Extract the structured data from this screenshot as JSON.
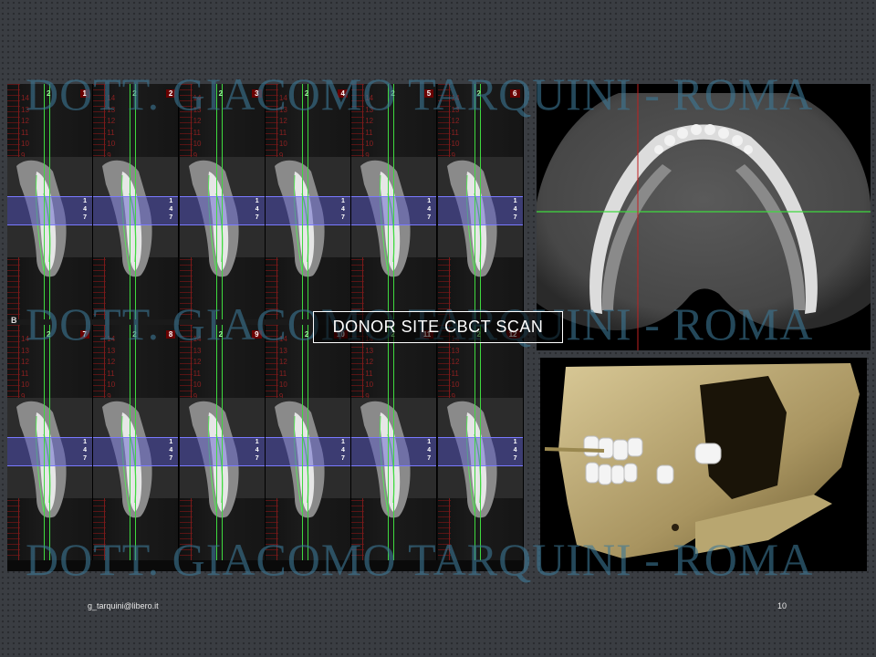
{
  "slide": {
    "watermark": "DOTT. GIACOMO TARQUINI - ROMA",
    "label": "DONOR SITE CBCT SCAN",
    "footer_email": "g_tarquini@libero.it",
    "page_number": "10"
  },
  "cbct": {
    "row_b_letter": "B",
    "green_marker": "2",
    "band_labels": [
      "1",
      "4",
      "7"
    ],
    "ruler_ticks": [
      "14",
      "13",
      "12",
      "11",
      "10",
      "9",
      "8",
      "7",
      "6",
      "5",
      "4",
      "3",
      "2",
      "1"
    ],
    "slices_top": [
      "1",
      "2",
      "3",
      "4",
      "5",
      "6"
    ],
    "slices_bottom": [
      "7",
      "8",
      "9",
      "10",
      "11",
      "12"
    ]
  },
  "colors": {
    "background": "#3a3d42",
    "watermark": "#3c7896",
    "band": "#5050c8",
    "guide_lines": "#3fd93f",
    "ruler": "#7a1a1a"
  }
}
